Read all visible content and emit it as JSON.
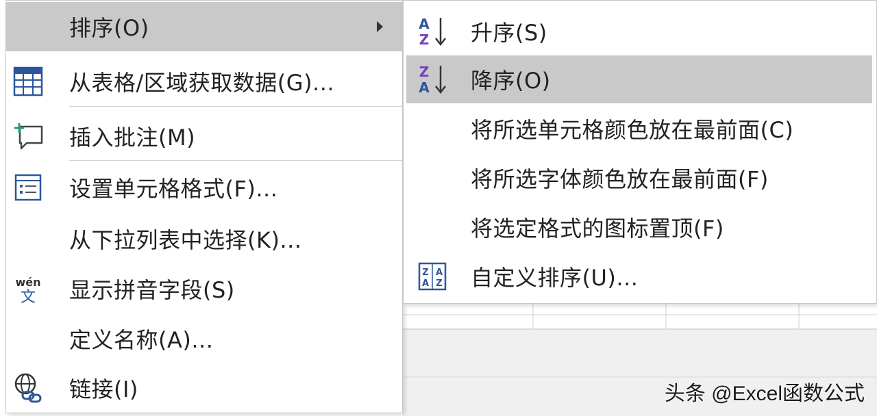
{
  "context_menu": {
    "items": [
      {
        "label": "排序(O)",
        "icon": "",
        "has_submenu": true
      },
      {
        "label": "从表格/区域获取数据(G)...",
        "icon": "table-icon"
      },
      {
        "label": "插入批注(M)",
        "icon": "new-comment-icon"
      },
      {
        "label": "设置单元格格式(F)...",
        "icon": "format-cells-icon"
      },
      {
        "label": "从下拉列表中选择(K)...",
        "icon": ""
      },
      {
        "label": "显示拼音字段(S)",
        "icon": "phonetic-wen-icon"
      },
      {
        "label": "定义名称(A)...",
        "icon": ""
      },
      {
        "label": "链接(I)",
        "icon": "link-globe-icon"
      }
    ]
  },
  "sort_submenu": {
    "items": [
      {
        "label": "升序(S)",
        "icon": "sort-ascending-icon"
      },
      {
        "label": "降序(O)",
        "icon": "sort-descending-icon"
      },
      {
        "label": "将所选单元格颜色放在最前面(C)",
        "icon": ""
      },
      {
        "label": "将所选字体颜色放在最前面(F)",
        "icon": ""
      },
      {
        "label": "将选定格式的图标置顶(F)",
        "icon": ""
      },
      {
        "label": "自定义排序(U)...",
        "icon": "custom-sort-icon"
      }
    ]
  },
  "watermark": "头条 @Excel函数公式",
  "colors": {
    "highlight": "#c9c9c9",
    "icon_blue": "#2b579a",
    "icon_purple": "#7a3fb8",
    "icon_green": "#21a366"
  }
}
